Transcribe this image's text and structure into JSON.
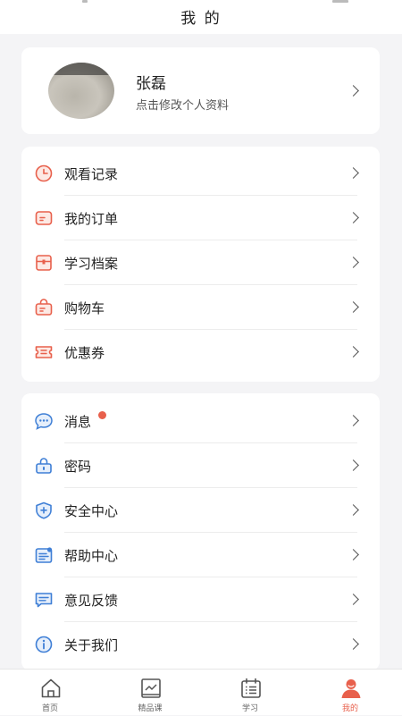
{
  "header": {
    "title": "我 的"
  },
  "profile": {
    "name": "张磊",
    "subtitle": "点击修改个人资料"
  },
  "menu_group_1": [
    {
      "label": "观看记录",
      "icon": "clock-icon"
    },
    {
      "label": "我的订单",
      "icon": "order-icon"
    },
    {
      "label": "学习档案",
      "icon": "archive-icon"
    },
    {
      "label": "购物车",
      "icon": "cart-icon"
    },
    {
      "label": "优惠券",
      "icon": "coupon-icon"
    }
  ],
  "menu_group_2": [
    {
      "label": "消息",
      "icon": "message-icon",
      "badge": true
    },
    {
      "label": "密码",
      "icon": "lock-icon"
    },
    {
      "label": "安全中心",
      "icon": "shield-icon"
    },
    {
      "label": "帮助中心",
      "icon": "help-icon"
    },
    {
      "label": "意见反馈",
      "icon": "feedback-icon"
    },
    {
      "label": "关于我们",
      "icon": "info-icon"
    }
  ],
  "tabbar": [
    {
      "label": "首页",
      "icon": "home-icon",
      "active": false
    },
    {
      "label": "精品课",
      "icon": "course-icon",
      "active": false
    },
    {
      "label": "学习",
      "icon": "calendar-icon",
      "active": false
    },
    {
      "label": "我的",
      "icon": "user-icon",
      "active": true
    }
  ],
  "colors": {
    "accent": "#e8604c",
    "blue": "#3f7fd6",
    "background": "#f4f4f6"
  }
}
